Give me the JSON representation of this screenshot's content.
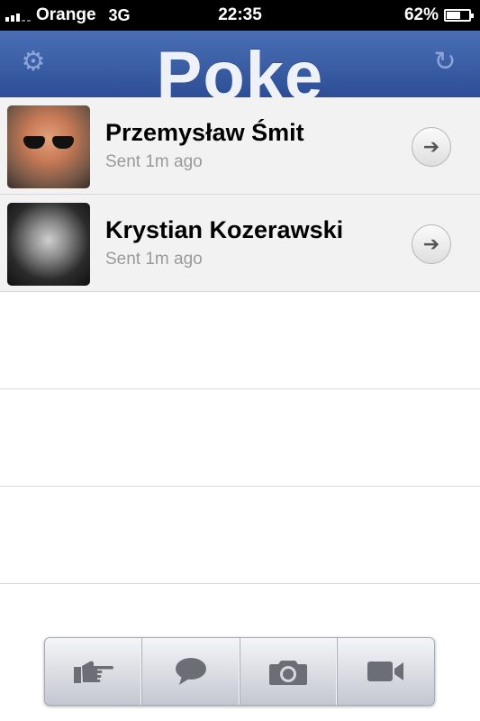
{
  "status_bar": {
    "carrier": "Orange",
    "network": "3G",
    "time": "22:35",
    "battery_text": "62%",
    "battery_level": 0.62,
    "signal_bars_on": 3,
    "signal_bars_total": 5
  },
  "nav": {
    "title": "Poke",
    "left_icon": "gear-icon",
    "right_icon": "refresh-icon",
    "left_glyph": "⚙",
    "right_glyph": "↻"
  },
  "contacts": [
    {
      "name": "Przemysław Śmit",
      "status": "Sent 1m ago",
      "action_glyph": "➔"
    },
    {
      "name": "Krystian Kozerawski",
      "status": "Sent 1m ago",
      "action_glyph": "➔"
    }
  ],
  "toolbar": {
    "buttons": [
      "poke-hand-icon",
      "chat-bubble-icon",
      "camera-icon",
      "video-camera-icon"
    ]
  },
  "colors": {
    "nav_top": "#4a6fb5",
    "nav_bottom": "#2d4e96",
    "row_background": "#f2f2f2",
    "icon_gray": "#6b6e74"
  }
}
